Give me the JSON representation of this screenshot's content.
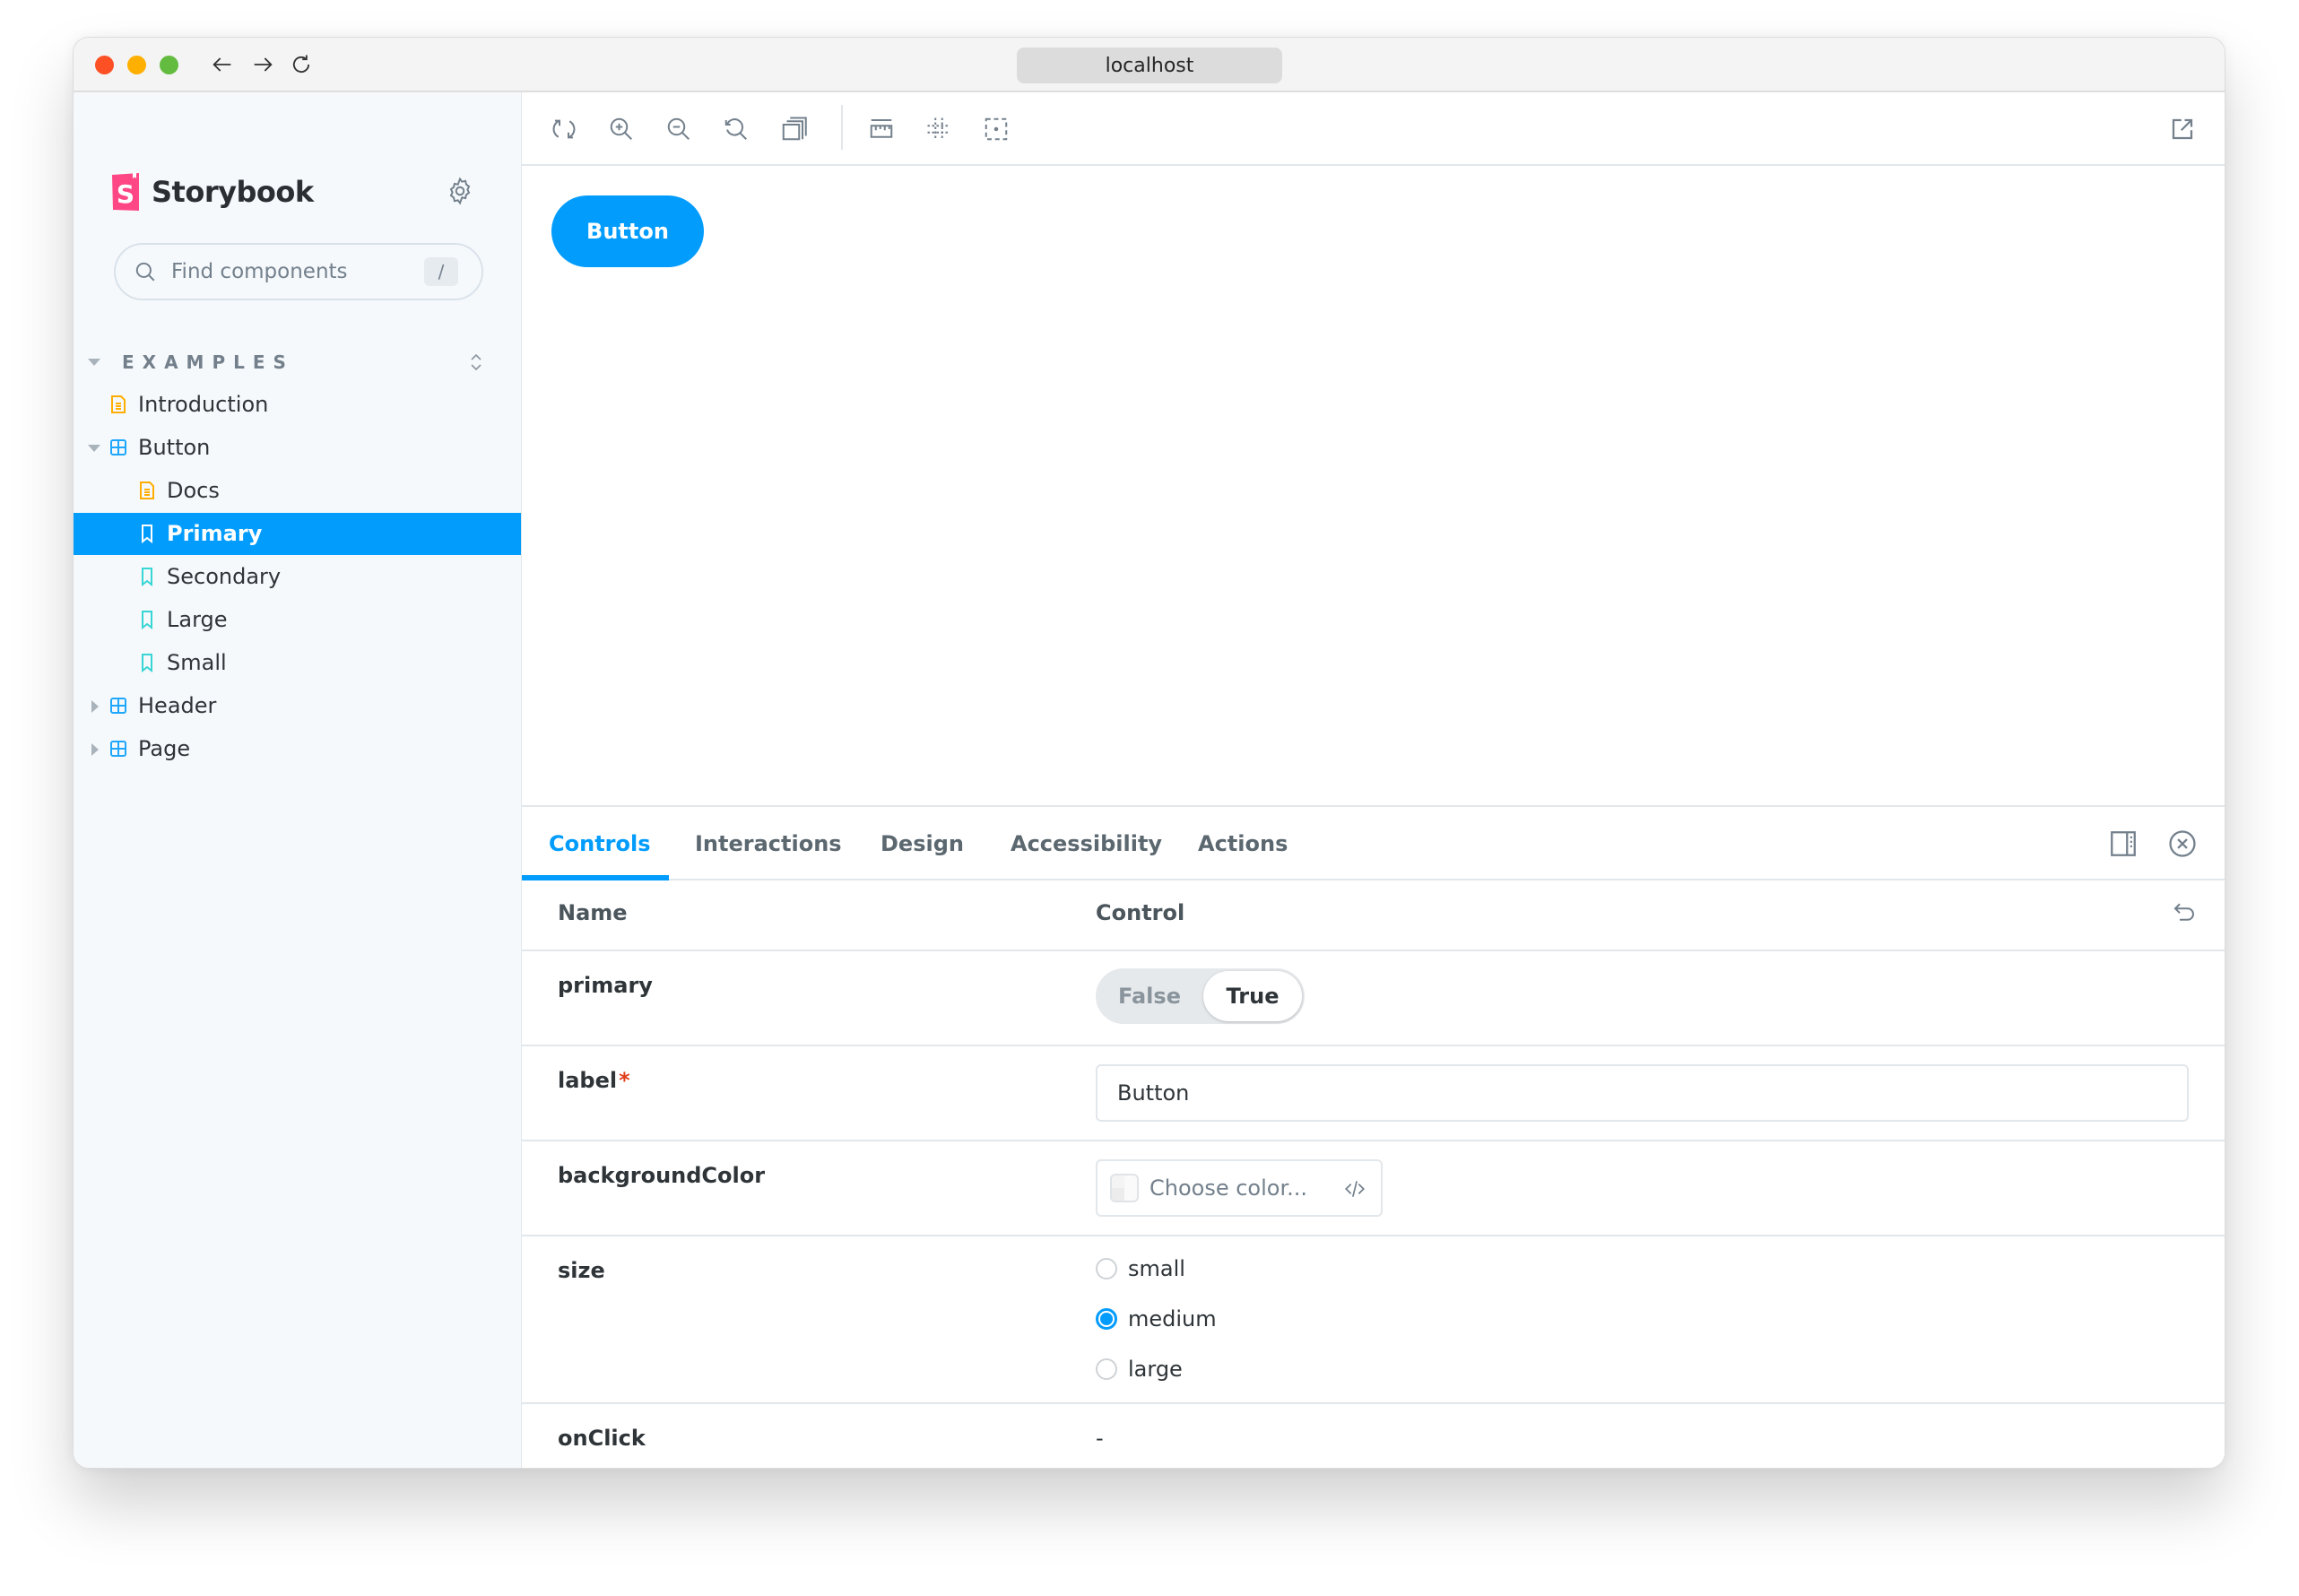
{
  "browser": {
    "url": "localhost",
    "nav": {
      "back_icon": "arrow-left-icon",
      "forward_icon": "arrow-right-icon",
      "reload_icon": "reload-icon"
    }
  },
  "sidebar": {
    "brand": "Storybook",
    "settings_icon": "gear-icon",
    "search": {
      "placeholder": "Find components",
      "value": "",
      "shortcut": "/"
    },
    "group": {
      "label": "EXAMPLES",
      "expanded": true
    },
    "tree": [
      {
        "label": "Introduction",
        "type": "docs",
        "level": 0,
        "expandable": false,
        "selected": false
      },
      {
        "label": "Button",
        "type": "component",
        "level": 0,
        "expandable": true,
        "expanded": true,
        "selected": false
      },
      {
        "label": "Docs",
        "type": "docs",
        "level": 1,
        "expandable": false,
        "selected": false
      },
      {
        "label": "Primary",
        "type": "story",
        "level": 1,
        "expandable": false,
        "selected": true
      },
      {
        "label": "Secondary",
        "type": "story",
        "level": 1,
        "expandable": false,
        "selected": false
      },
      {
        "label": "Large",
        "type": "story",
        "level": 1,
        "expandable": false,
        "selected": false
      },
      {
        "label": "Small",
        "type": "story",
        "level": 1,
        "expandable": false,
        "selected": false
      },
      {
        "label": "Header",
        "type": "component",
        "level": 0,
        "expandable": true,
        "expanded": false,
        "selected": false
      },
      {
        "label": "Page",
        "type": "component",
        "level": 0,
        "expandable": true,
        "expanded": false,
        "selected": false
      }
    ]
  },
  "toolbar": {
    "left_tools": [
      "remount-icon",
      "zoom-in-icon",
      "zoom-out-icon",
      "zoom-reset-icon",
      "backgrounds-icon"
    ],
    "right_tools": [
      "measure-icon",
      "grid-icon",
      "outline-icon"
    ],
    "open_new_tab_icon": "open-external-icon"
  },
  "preview": {
    "button_label": "Button"
  },
  "addons": {
    "tabs": [
      {
        "label": "Controls",
        "active": true
      },
      {
        "label": "Interactions",
        "active": false
      },
      {
        "label": "Design",
        "active": false
      },
      {
        "label": "Accessibility",
        "active": false
      },
      {
        "label": "Actions",
        "active": false
      }
    ],
    "panel_icons": [
      "sidebar-right-icon",
      "close-circle-icon"
    ],
    "controls": {
      "header": {
        "name": "Name",
        "control": "Control"
      },
      "rows": {
        "primary": {
          "name": "primary",
          "options": [
            "False",
            "True"
          ],
          "value": "True"
        },
        "label": {
          "name": "label",
          "required_mark": "*",
          "value": "Button"
        },
        "backgroundColor": {
          "name": "backgroundColor",
          "placeholder": "Choose color..."
        },
        "size": {
          "name": "size",
          "options": [
            "small",
            "medium",
            "large"
          ],
          "value": "medium"
        },
        "onClick": {
          "name": "onClick",
          "value": "-"
        }
      }
    }
  },
  "colors": {
    "accent": "#029cfd",
    "sidebar_bg": "#f6f9fc",
    "brand_pink": "#ff4785",
    "docs_icon": "#ffae00",
    "story_icon": "#37d5d3",
    "component_icon": "#1ea7fd",
    "required": "#e03e1a"
  }
}
